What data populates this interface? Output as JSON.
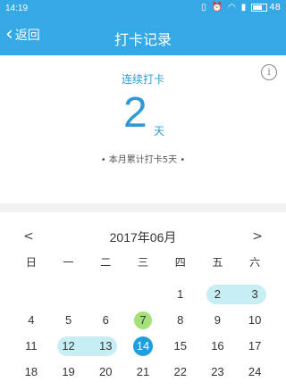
{
  "status": {
    "time": "14:19",
    "battery": "48"
  },
  "nav": {
    "back_label": "返回",
    "title": "打卡记录"
  },
  "summary": {
    "streak_label": "连续打卡",
    "streak_days": "2",
    "streak_unit": "天",
    "month_total": "• 本月累计打卡5天 •",
    "info_icon": "i"
  },
  "calendar": {
    "prev": "<",
    "next": ">",
    "month": "2017年06月",
    "weekdays": [
      "日",
      "一",
      "二",
      "三",
      "四",
      "五",
      "六"
    ],
    "days": [
      {
        "label": "",
        "state": ""
      },
      {
        "label": "",
        "state": ""
      },
      {
        "label": "",
        "state": ""
      },
      {
        "label": "",
        "state": ""
      },
      {
        "label": "1",
        "state": ""
      },
      {
        "label": "2",
        "state": "checked start"
      },
      {
        "label": "3",
        "state": "checked end"
      },
      {
        "label": "4",
        "state": ""
      },
      {
        "label": "5",
        "state": ""
      },
      {
        "label": "6",
        "state": ""
      },
      {
        "label": "7",
        "state": "today"
      },
      {
        "label": "8",
        "state": ""
      },
      {
        "label": "9",
        "state": ""
      },
      {
        "label": "10",
        "state": ""
      },
      {
        "label": "11",
        "state": ""
      },
      {
        "label": "12",
        "state": "checked start"
      },
      {
        "label": "13",
        "state": "checked end"
      },
      {
        "label": "14",
        "state": "selected"
      },
      {
        "label": "15",
        "state": ""
      },
      {
        "label": "16",
        "state": ""
      },
      {
        "label": "17",
        "state": ""
      },
      {
        "label": "18",
        "state": ""
      },
      {
        "label": "19",
        "state": ""
      },
      {
        "label": "20",
        "state": ""
      },
      {
        "label": "21",
        "state": ""
      },
      {
        "label": "22",
        "state": ""
      },
      {
        "label": "23",
        "state": ""
      },
      {
        "label": "24",
        "state": ""
      }
    ]
  }
}
